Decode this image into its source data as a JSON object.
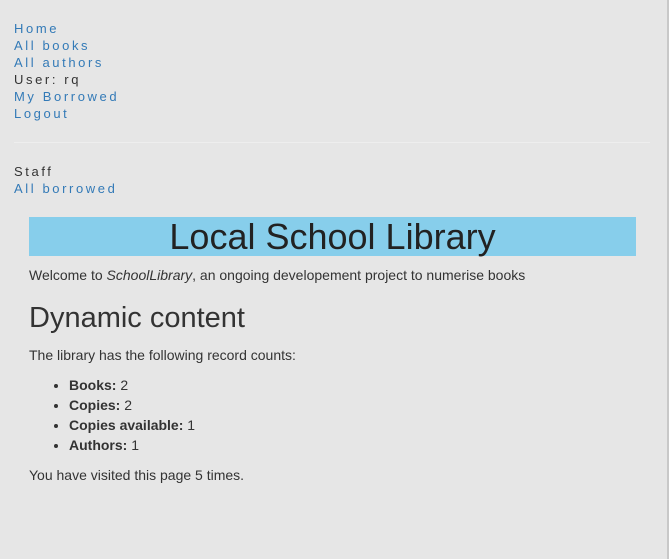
{
  "nav": {
    "home": "Home",
    "all_books": "All books",
    "all_authors": "All authors",
    "user": "User: rq",
    "my_borrowed": "My Borrowed",
    "logout": "Logout"
  },
  "staff": {
    "heading": "Staff",
    "all_borrowed": "All borrowed"
  },
  "main": {
    "title": "Local School Library",
    "welcome_prefix": "Welcome to ",
    "welcome_brand": "SchoolLibrary",
    "welcome_suffix": ", an ongoing developement project to numerise books",
    "dynamic_heading": "Dynamic content",
    "records_intro": "The library has the following record counts:",
    "counts": [
      {
        "label": "Books:",
        "value": "2"
      },
      {
        "label": "Copies:",
        "value": "2"
      },
      {
        "label": "Copies available:",
        "value": "1"
      },
      {
        "label": "Authors:",
        "value": "1"
      }
    ],
    "visits_prefix": "You have visited this page ",
    "visits_count": "5",
    "visits_suffix": " times."
  },
  "colors": {
    "banner": "#87ceeb",
    "link": "#337ab7",
    "background": "#e6e6e6"
  }
}
